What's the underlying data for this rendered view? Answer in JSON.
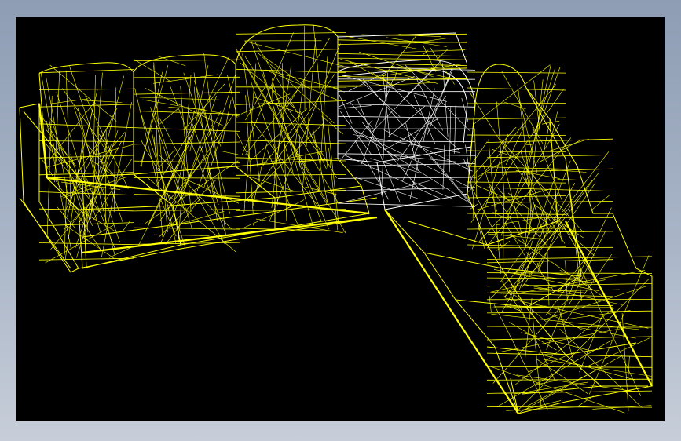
{
  "viewport": {
    "background_color": "#000000",
    "frame_gradient": [
      "#8e9db4",
      "#c7ced9"
    ],
    "content": "wireframe-model",
    "wire_colors": {
      "primary": "#ffff00",
      "secondary": "#ffffff"
    }
  }
}
